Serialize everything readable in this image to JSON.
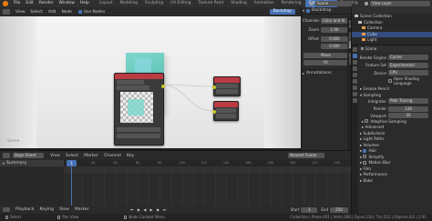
{
  "topbar": {
    "menus": [
      "File",
      "Edit",
      "Render",
      "Window",
      "Help"
    ],
    "workspaces": [
      "Layout",
      "Modeling",
      "Sculpting",
      "UV Editing",
      "Texture Paint",
      "Shading",
      "Animation",
      "Rendering",
      "Compositing",
      "Scripting"
    ],
    "active_workspace": "Compositing",
    "scene": "Scene",
    "view_layer": "View Layer"
  },
  "node_editor": {
    "menus": [
      "View",
      "Select",
      "Add",
      "Node"
    ],
    "use_nodes_label": "Use Nodes",
    "backdrop_button": "Backdrop",
    "corner_label": "Scene"
  },
  "backdrop_panel": {
    "title": "Backdrop",
    "channels_label": "Channels",
    "channels_value": "Color and Al...",
    "zoom_label": "Zoom",
    "zoom_value": "1.00",
    "offset_label": "Offset",
    "offset_x": "0.000",
    "offset_y": "0.000",
    "move_button": "Move",
    "fit_button": "Fit",
    "annotations_label": "Annotations",
    "tabs": [
      "Node",
      "Tool",
      "View",
      "Options"
    ]
  },
  "outliner": {
    "items": [
      "Scene Collection",
      "Collection",
      "Camera",
      "Cube",
      "Light"
    ]
  },
  "properties": {
    "scene_label": "Scene",
    "render_engine_label": "Render Engine",
    "render_engine_value": "Cycles",
    "feature_set_label": "Feature Set",
    "feature_set_value": "Experimental",
    "device_label": "Device",
    "device_value": "CPU",
    "open_shading_label": "Open Shading Language",
    "grease_pencil": "Grease Pencil",
    "sampling": "Sampling",
    "integrator_label": "Integrator",
    "integrator_value": "Path Tracing",
    "render_label": "Render",
    "render_value": "128",
    "viewport_label": "Viewport",
    "viewport_value": "32",
    "adaptive_sampling": "Adaptive Sampling",
    "advanced": "Advanced",
    "subdivision": "Subdivision",
    "light_paths": "Light Paths",
    "volumes": "Volumes",
    "hair": "Hair",
    "simplify": "Simplify",
    "motion_blur": "Motion Blur",
    "film": "Film",
    "performance": "Performance",
    "bake": "Bake"
  },
  "dope_sheet": {
    "mode": "Dope Sheet",
    "menus": [
      "View",
      "Select",
      "Marker",
      "Channel",
      "Key"
    ],
    "frame_mode": "Nearest Frame",
    "summary": "Summary",
    "current_frame": "1",
    "ticks": [
      "0",
      "10",
      "20",
      "30",
      "40",
      "50",
      "60",
      "70",
      "80",
      "90",
      "100",
      "110",
      "120",
      "130",
      "140",
      "150",
      "160",
      "170",
      "180",
      "190",
      "200",
      "210",
      "220",
      "230",
      "240",
      "250"
    ]
  },
  "playback": {
    "menus": [
      "Playback",
      "Keying",
      "View",
      "Marker"
    ],
    "start_label": "Start",
    "start_value": "1",
    "end_label": "End",
    "end_value": "250"
  },
  "status_bar": {
    "items": [
      "Select",
      "Pan View",
      "Node Context Menu"
    ],
    "stats": "Collection | Plane.001 | Verts:180 | Faces:118 | Tris:212 | Objects:2/3 | 2.91"
  }
}
